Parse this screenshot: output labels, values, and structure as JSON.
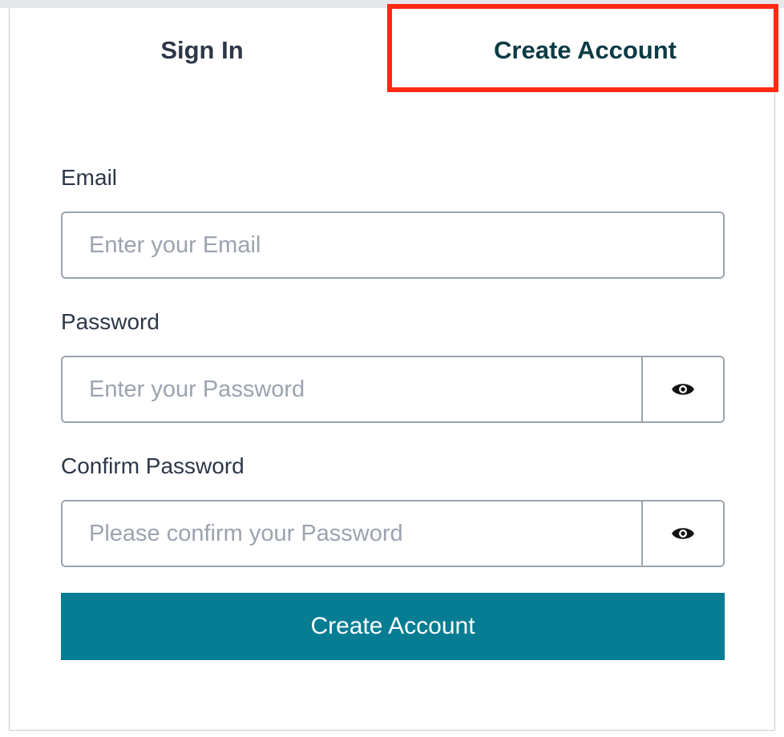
{
  "tabs": {
    "sign_in": "Sign In",
    "create_account": "Create Account"
  },
  "form": {
    "email": {
      "label": "Email",
      "placeholder": "Enter your Email"
    },
    "password": {
      "label": "Password",
      "placeholder": "Enter your Password"
    },
    "confirm_password": {
      "label": "Confirm Password",
      "placeholder": "Please confirm your Password"
    },
    "submit_label": "Create Account"
  },
  "icons": {
    "password_toggle": "eye-icon",
    "confirm_toggle": "eye-icon"
  },
  "colors": {
    "accent": "#077d93",
    "highlight": "#ff2a12",
    "active_tab_text": "#0c3b45",
    "text": "#2d3748",
    "placeholder": "#9ca3af",
    "border": "#9aa3ad"
  }
}
